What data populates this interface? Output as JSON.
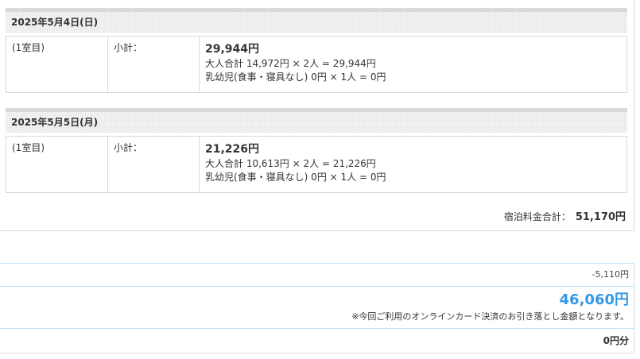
{
  "days": [
    {
      "date": "2025年5月4日(日)",
      "room": "(1室目)",
      "subtotal_label": "小計：",
      "subtotal": "29,944円",
      "adult_line": "大人合計 14,972円 × 2人 = 29,944円",
      "infant_line": "乳幼児(食事・寝具なし) 0円 × 1人 = 0円"
    },
    {
      "date": "2025年5月5日(月)",
      "room": "(1室目)",
      "subtotal_label": "小計：",
      "subtotal": "21,226円",
      "adult_line": "大人合計 10,613円 × 2人 = 21,226円",
      "infant_line": "乳幼児(食事・寝具なし) 0円 × 1人 = 0円"
    }
  ],
  "total": {
    "label": "宿泊料金合計：",
    "value": "51,170円"
  },
  "payment": {
    "discount": "-5,110円",
    "amount": "46,060円",
    "note": "※今回ご利用のオンラインカード決済のお引き落とし金額となります。",
    "points": "0円分"
  },
  "colors": {
    "accent": "#3399e6",
    "border": "#d9d9d9",
    "pay_border": "#bfe3f2"
  }
}
